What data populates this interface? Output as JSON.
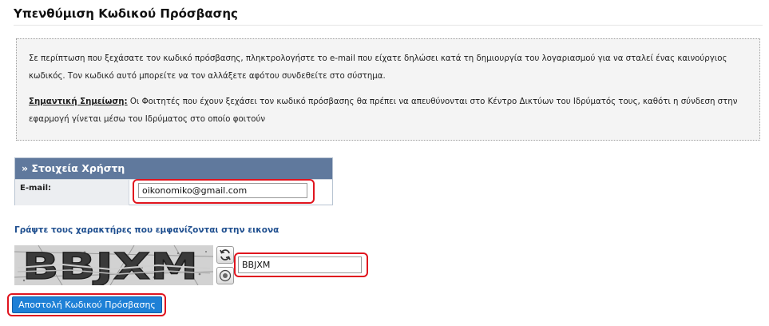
{
  "page": {
    "title": "Υπενθύμιση Κωδικού Πρόσβασης"
  },
  "info": {
    "paragraph": "Σε περίπτωση που ξεχάσατε τον κωδικό πρόσβασης, πληκτρολογήστε το e-mail που είχατε δηλώσει κατά τη δημιουργία του λογαριασμού για να σταλεί ένας καινούργιος κωδικός. Τον κωδικό αυτό μπορείτε να τον αλλάξετε αφότου συνδεθείτε στο σύστημα.",
    "note_label": "Σημαντική Σημείωση:",
    "note_text": " Οι Φοιτητές που έχουν ξεχάσει τον κωδικό πρόσβασης θα πρέπει να απευθύνονται στο Κέντρο Δικτύων του Ιδρύματός τους, καθότι η σύνδεση στην εφαρμογή γίνεται μέσω του Ιδρύματος στο οποίο φοιτούν"
  },
  "form": {
    "header": "» Στοιχεία Χρήστη",
    "email_label": "E-mail:",
    "email_value": "oikonomiko@gmail.com"
  },
  "captcha": {
    "heading": "Γράψτε τους χαρακτήρες που εμφανίζονται στην εικονα",
    "image_text": "BBJXM",
    "input_value": "BBJXM",
    "refresh_icon": "refresh-icon",
    "audio_icon": "audio-icon"
  },
  "submit": {
    "label": "Αποστολή Κωδικού Πρόσβασης"
  },
  "colors": {
    "header_bg": "#60799d",
    "button_bg": "#1e80d6",
    "highlight": "#e0141e",
    "heading_blue": "#1f4f8f"
  }
}
